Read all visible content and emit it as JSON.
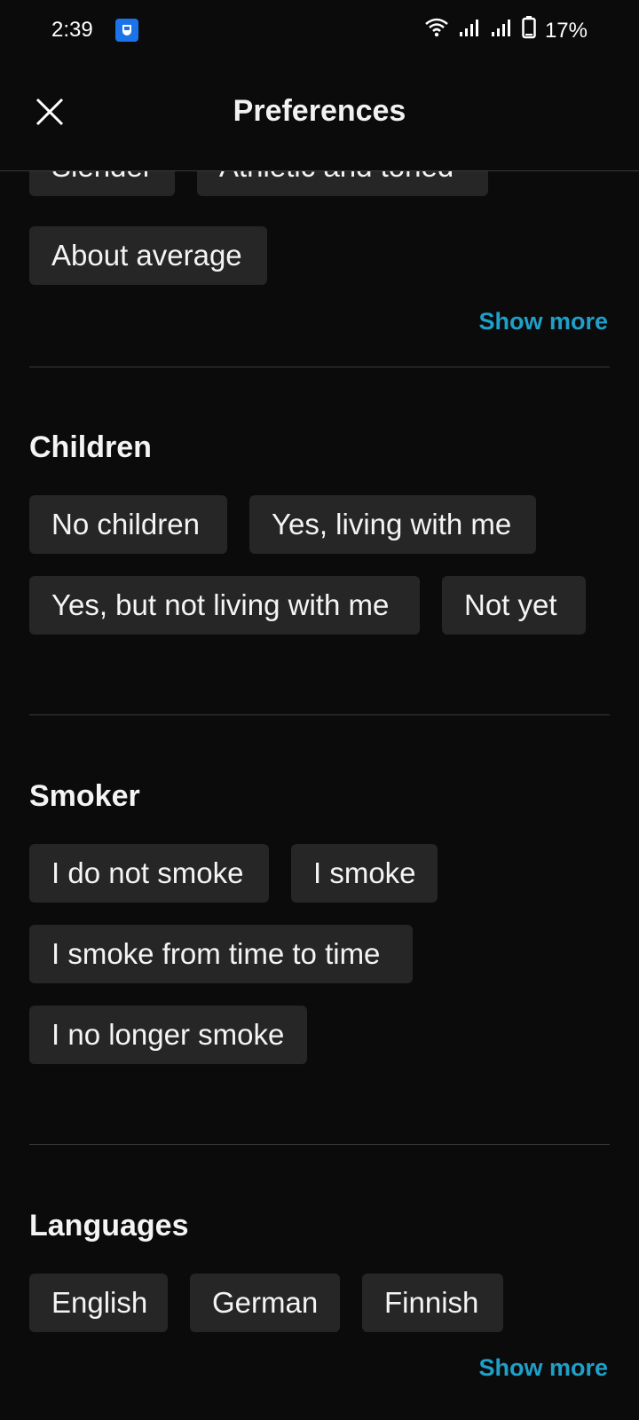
{
  "status_bar": {
    "time": "2:39",
    "battery": "17%",
    "icons": [
      "app-notification-icon",
      "wifi-icon",
      "signal-icon",
      "signal-icon",
      "battery-icon"
    ]
  },
  "header": {
    "title": "Preferences",
    "close_icon": "close-icon"
  },
  "body_type": {
    "chips": [
      "Slender",
      "Athletic and toned",
      "About average"
    ],
    "show_more": "Show more"
  },
  "children": {
    "title": "Children",
    "chips": [
      "No children",
      "Yes, living with me",
      "Yes, but not living with me",
      "Not yet"
    ]
  },
  "smoker": {
    "title": "Smoker",
    "chips": [
      "I do not smoke",
      "I smoke",
      "I smoke from time to time",
      "I no longer smoke"
    ]
  },
  "languages": {
    "title": "Languages",
    "chips": [
      "English",
      "German",
      "Finnish"
    ],
    "show_more": "Show more"
  },
  "colors": {
    "background": "#0b0b0c",
    "chip": "#262626",
    "accent": "#1ea0c8",
    "divider": "#3a3a3a"
  }
}
